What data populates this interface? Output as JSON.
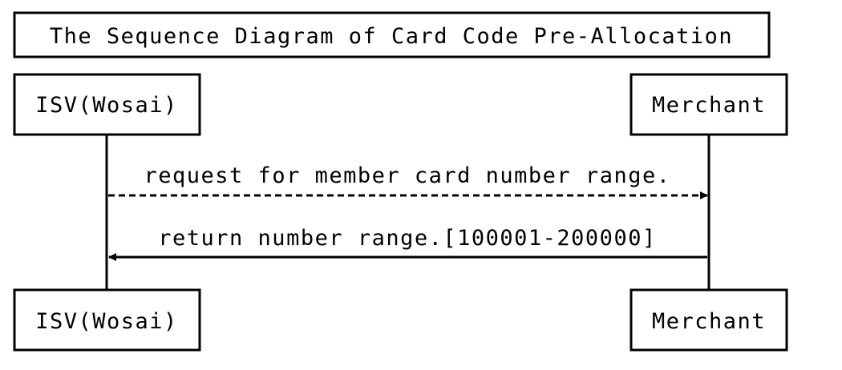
{
  "title": "The Sequence Diagram of Card Code Pre-Allocation",
  "participants": [
    {
      "id": "isv",
      "label": "ISV(Wosai)"
    },
    {
      "id": "merchant",
      "label": "Merchant"
    }
  ],
  "messages": [
    {
      "from": "isv",
      "to": "merchant",
      "style": "dashed",
      "label": "request for member card number range."
    },
    {
      "from": "merchant",
      "to": "isv",
      "style": "solid",
      "label": "return number range.[100001-200000]"
    }
  ],
  "colors": {
    "ink": "#000000",
    "background": "#ffffff"
  }
}
